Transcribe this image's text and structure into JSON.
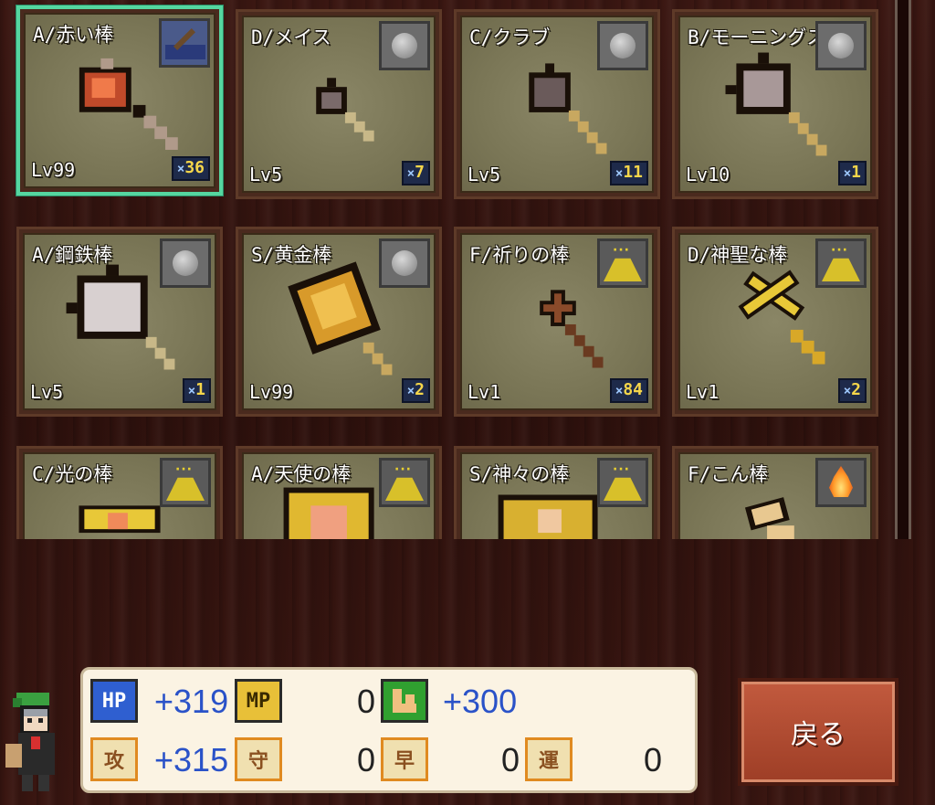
{
  "items": [
    {
      "name": "A/赤い棒",
      "level": "Lv99",
      "count": "36",
      "element": "water-icon",
      "weapon": "red-staff"
    },
    {
      "name": "D/メイス",
      "level": "Lv5",
      "count": "7",
      "element": "stone-icon",
      "weapon": "mace"
    },
    {
      "name": "C/クラブ",
      "level": "Lv5",
      "count": "11",
      "element": "stone-icon",
      "weapon": "club"
    },
    {
      "name": "B/モーニングスター",
      "level": "Lv10",
      "count": "1",
      "element": "stone-icon",
      "weapon": "morningstar"
    },
    {
      "name": "A/鋼鉄棒",
      "level": "Lv5",
      "count": "1",
      "element": "stone-icon",
      "weapon": "steel-mace"
    },
    {
      "name": "S/黄金棒",
      "level": "Lv99",
      "count": "2",
      "element": "stone-icon",
      "weapon": "gold-club"
    },
    {
      "name": "F/祈りの棒",
      "level": "Lv1",
      "count": "84",
      "element": "sand-icon",
      "weapon": "prayer-rod"
    },
    {
      "name": "D/神聖な棒",
      "level": "Lv1",
      "count": "2",
      "element": "sand-icon",
      "weapon": "holy-rod"
    },
    {
      "name": "C/光の棒",
      "level": "",
      "count": "",
      "element": "sand-icon",
      "weapon": "light-rod"
    },
    {
      "name": "A/天使の棒",
      "level": "",
      "count": "",
      "element": "sand-icon",
      "weapon": "angel-rod"
    },
    {
      "name": "S/神々の棒",
      "level": "",
      "count": "",
      "element": "sand-icon",
      "weapon": "gods-rod"
    },
    {
      "name": "F/こん棒",
      "level": "",
      "count": "",
      "element": "fire-icon",
      "weapon": "cudgel"
    }
  ],
  "status": {
    "hp_label": "HP",
    "hp_value": "+319",
    "mp_label": "MP",
    "mp_value": "0",
    "pow_value": "+300",
    "atk_label": "攻",
    "atk_value": "+315",
    "def_label": "守",
    "def_value": "0",
    "spd_label": "早",
    "spd_value": "0",
    "luck_label": "運",
    "luck_value": "0"
  },
  "back_button": "戻る",
  "colors": {
    "selected_border": "#55d6a0",
    "stat_blue": "#2a52c8",
    "button": "#b04a30"
  }
}
